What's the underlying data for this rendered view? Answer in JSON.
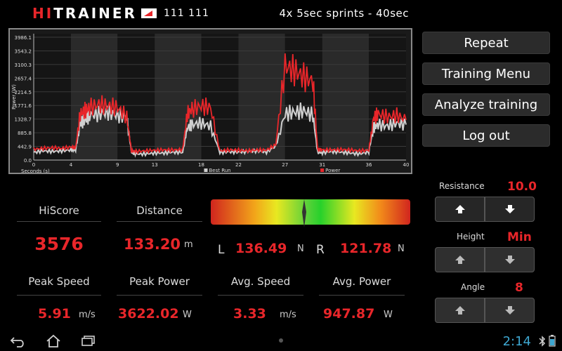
{
  "header": {
    "logo_hi": "HI",
    "logo_trainer": "TRAINER",
    "device_id": "111 111",
    "workout_title": "4x 5sec sprints - 40sec"
  },
  "chart_data": {
    "type": "line",
    "ylabel": "Power (W)",
    "xlabel": "Seconds (s)",
    "x_ticks": [
      "0",
      "4",
      "9",
      "13",
      "18",
      "22",
      "27",
      "31",
      "36",
      "40"
    ],
    "y_ticks": [
      "0.0",
      "442.9",
      "885.8",
      "1328.7",
      "1771.6",
      "2214.5",
      "2657.4",
      "3100.3",
      "3543.2",
      "3986.1"
    ],
    "xlim": [
      0,
      40
    ],
    "ylim": [
      0,
      4100
    ],
    "grid": true,
    "legend_position": "bottom",
    "series": [
      {
        "name": "Best Run",
        "color": "#cfcfcf",
        "x": [
          0,
          1,
          2,
          3,
          4,
          4.5,
          5,
          5.5,
          6,
          7,
          8,
          9,
          10,
          10.5,
          11,
          12,
          13,
          14,
          15,
          16,
          16.5,
          17,
          18,
          19,
          20,
          21,
          22,
          23,
          24,
          25,
          26,
          27,
          28,
          29,
          30,
          30.5,
          31,
          32,
          33,
          34,
          35,
          36,
          36.5,
          37,
          38,
          39,
          40
        ],
        "y": [
          250,
          300,
          280,
          300,
          330,
          320,
          1200,
          1300,
          1450,
          1500,
          1550,
          1450,
          1400,
          250,
          200,
          200,
          230,
          230,
          260,
          250,
          1050,
          1150,
          1200,
          1100,
          250,
          270,
          260,
          280,
          300,
          260,
          450,
          1500,
          1550,
          1600,
          1450,
          250,
          240,
          280,
          260,
          230,
          200,
          270,
          1050,
          1150,
          1100,
          1200,
          1150
        ]
      },
      {
        "name": "Power",
        "color": "#e8262a",
        "x": [
          0,
          1,
          2,
          3,
          4,
          4.5,
          5,
          5.5,
          6,
          7,
          8,
          9,
          10,
          10.5,
          11,
          12,
          13,
          14,
          15,
          16,
          16.5,
          17,
          18,
          19,
          20,
          21,
          22,
          23,
          24,
          25,
          26,
          27,
          28,
          29,
          30,
          30.5,
          31,
          32,
          33,
          34,
          35,
          36,
          36.5,
          37,
          38,
          39,
          40
        ],
        "y": [
          350,
          380,
          400,
          380,
          420,
          400,
          1500,
          1600,
          1700,
          1800,
          1750,
          1700,
          1400,
          300,
          280,
          300,
          320,
          330,
          330,
          340,
          1500,
          1650,
          1750,
          1700,
          300,
          330,
          320,
          300,
          330,
          320,
          500,
          3050,
          2900,
          2700,
          2550,
          350,
          330,
          330,
          340,
          330,
          300,
          320,
          1350,
          1500,
          1400,
          1450,
          1300
        ]
      }
    ]
  },
  "menu": {
    "repeat": "Repeat",
    "training_menu": "Training Menu",
    "analyze": "Analyze training",
    "logout": "Log out"
  },
  "stats": {
    "hiscore_label": "HiScore",
    "hiscore_value": "3576",
    "distance_label": "Distance",
    "distance_value": "133.20",
    "distance_unit": "m",
    "peak_speed_label": "Peak Speed",
    "peak_speed_value": "5.91",
    "peak_speed_unit": "m/s",
    "peak_power_label": "Peak Power",
    "peak_power_value": "3622.02",
    "peak_power_unit": "W",
    "avg_speed_label": "Avg. Speed",
    "avg_speed_value": "3.33",
    "avg_speed_unit": "m/s",
    "avg_power_label": "Avg. Power",
    "avg_power_value": "947.87",
    "avg_power_unit": "W"
  },
  "balance": {
    "left_label": "L",
    "left_value": "136.49",
    "left_unit": "N",
    "right_label": "R",
    "right_value": "121.78",
    "right_unit": "N",
    "needle_position_fraction": 0.47
  },
  "controls": {
    "resistance_label": "Resistance",
    "resistance_value": "10.0",
    "height_label": "Height",
    "height_value": "Min",
    "angle_label": "Angle",
    "angle_value": "8"
  },
  "statusbar": {
    "time": "2:14"
  }
}
